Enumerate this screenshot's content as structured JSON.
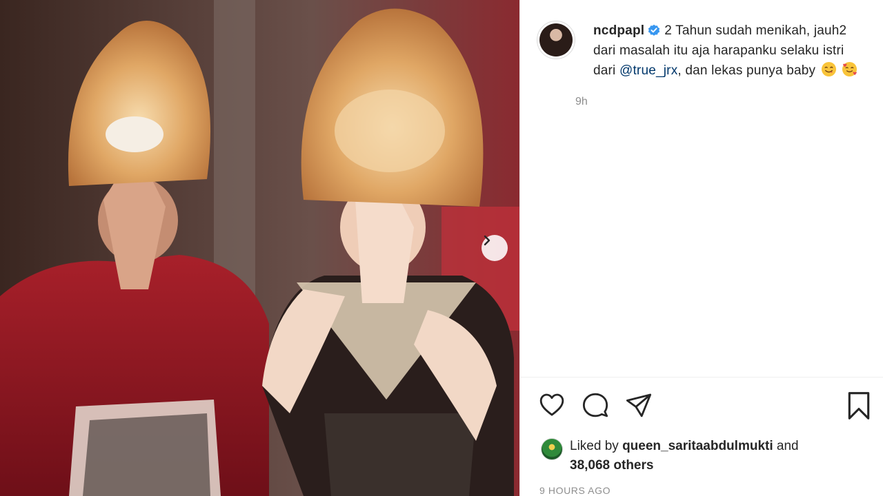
{
  "post": {
    "username": "ncdpapl",
    "caption_before_mention": "2 Tahun sudah menikah, jauh2 dari masalah itu aja harapanku selaku istri dari ",
    "mention": "@true_jrx",
    "caption_after_mention": ", dan lekas punya baby",
    "caption_emojis": [
      "yum-face-emoji",
      "smiling-face-with-hearts-emoji"
    ],
    "time_short": "9h",
    "liked_by_prefix": "Liked by",
    "liked_by_user": "queen_saritaabdulmukti",
    "liked_by_and": "and",
    "likes_others": "38,068 others",
    "time_long": "9 HOURS AGO"
  },
  "icons": {
    "verified": "verified-badge-icon",
    "next": "chevron-right-icon",
    "like": "heart-icon",
    "comment": "comment-icon",
    "share": "paper-plane-icon",
    "save": "bookmark-icon"
  },
  "colors": {
    "verified_blue": "#3897f0",
    "mention_blue": "#00376b",
    "secondary_text": "#8e8e8e"
  }
}
